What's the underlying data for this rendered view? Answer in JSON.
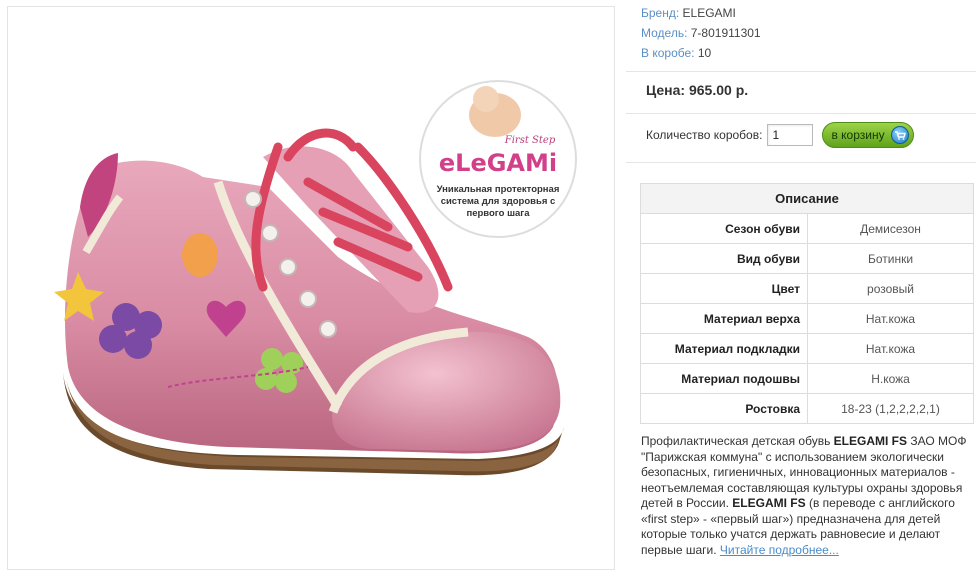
{
  "product": {
    "brand_label": "Бренд:",
    "brand": "ELEGAMI",
    "model_label": "Модель:",
    "model": "7-801911301",
    "box_label": "В коробе:",
    "box_count": "10"
  },
  "price": {
    "text": "Цена: 965.00 р."
  },
  "order": {
    "qty_label": "Количество коробов:",
    "qty_value": "1",
    "cart_label": "в корзину"
  },
  "badge": {
    "tagline": "First Step",
    "logo": "eLeGAMi",
    "lines": [
      "Уникальная протекторная",
      "система для здоровья с",
      "первого шага"
    ]
  },
  "specs": {
    "title": "Описание",
    "rows": [
      {
        "label": "Сезон обуви",
        "value": "Демисезон"
      },
      {
        "label": "Вид обуви",
        "value": "Ботинки"
      },
      {
        "label": "Цвет",
        "value": "розовый"
      },
      {
        "label": "Материал верха",
        "value": "Нат.кожа"
      },
      {
        "label": "Материал подкладки",
        "value": "Нат.кожа"
      },
      {
        "label": "Материал подошвы",
        "value": "Н.кожа"
      },
      {
        "label": "Ростовка",
        "value": "18-23 (1,2,2,2,2,1)"
      }
    ]
  },
  "description": {
    "p1": "Профилактическая детская обувь ",
    "b1": "ELEGAMI FS",
    "p2": " ЗАО МОФ \"Парижская коммуна\" с использованием экологически безопасных, гигиеничных, инновационных материалов - неотъемлемая составляющая культуры охраны здоровья детей в России. ",
    "b2": "ELEGAMI FS",
    "p3": " (в переводе с английского «first step» - «первый шаг») предназначена для детей которые только учатся держать равновесие и делают первые шаги. ",
    "link": "Читайте подробнее..."
  },
  "colors": {
    "meta_label": "#5a8fc5",
    "cart_green": "#6fb22a",
    "link": "#4a8cc9"
  }
}
